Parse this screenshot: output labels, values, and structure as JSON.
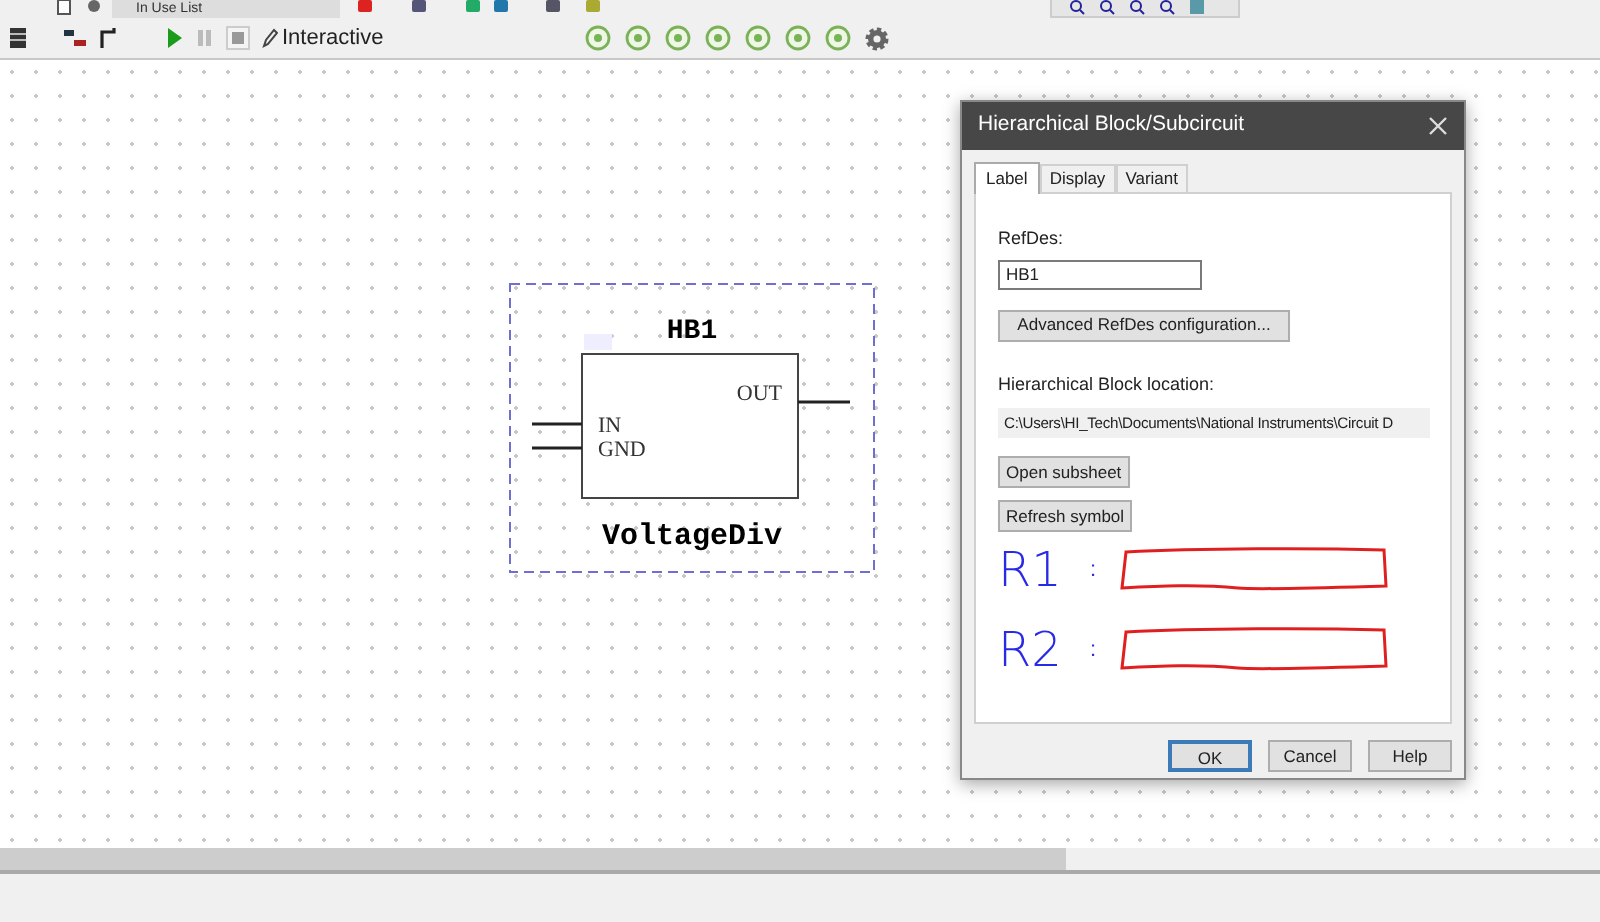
{
  "toolbar": {
    "list_dropdown": "In Use List",
    "mode": "Interactive"
  },
  "schematic": {
    "refdes": "HB1",
    "name": "VoltageDiv",
    "pins_left": [
      "IN",
      "GND"
    ],
    "pins_right": [
      "OUT"
    ]
  },
  "dialog": {
    "title": "Hierarchical Block/Subcircuit",
    "tabs": [
      {
        "label": "Label",
        "selected": true
      },
      {
        "label": "Display",
        "selected": false
      },
      {
        "label": "Variant",
        "selected": false
      }
    ],
    "refdes_label": "RefDes:",
    "refdes_value": "HB1",
    "advanced_button": "Advanced RefDes configuration...",
    "location_label": "Hierarchical Block location:",
    "location_value": "C:\\Users\\HI_Tech\\Documents\\National Instruments\\Circuit D",
    "buttons": [
      "Open subsheet",
      "Refresh symbol"
    ],
    "annotations": [
      {
        "label": "R1",
        "separator": ":"
      },
      {
        "label": "R2",
        "separator": ":"
      }
    ],
    "footer_buttons": [
      {
        "label": "OK",
        "default": true
      },
      {
        "label": "Cancel",
        "default": false
      },
      {
        "label": "Help",
        "default": false
      }
    ]
  }
}
